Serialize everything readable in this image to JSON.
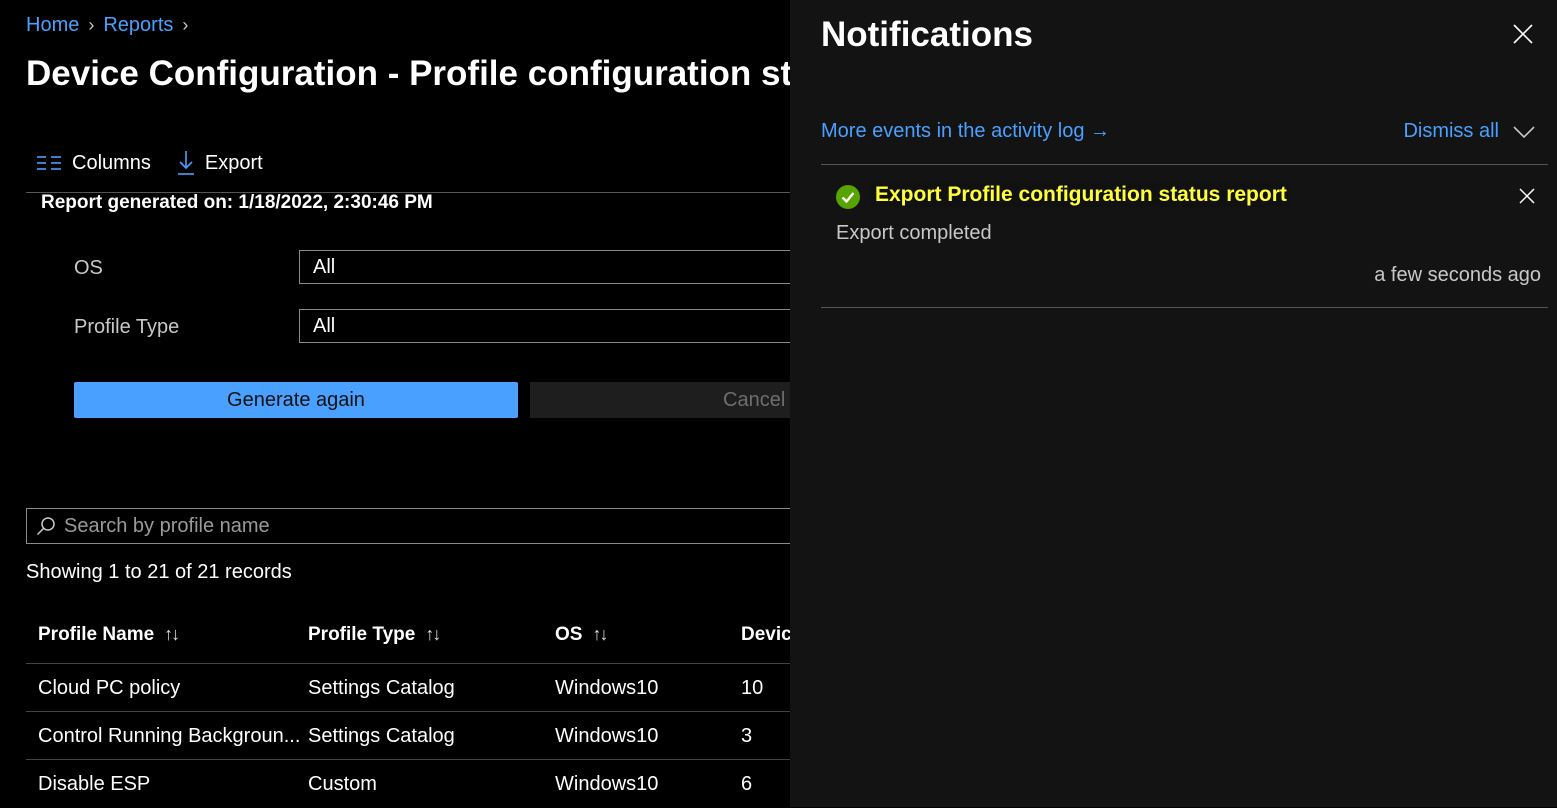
{
  "breadcrumb": {
    "items": [
      "Home",
      "Reports"
    ]
  },
  "page_title": "Device Configuration - Profile configuration sta",
  "toolbar": {
    "columns_label": "Columns",
    "export_label": "Export"
  },
  "report_generated": "Report generated on: 1/18/2022, 2:30:46 PM",
  "filters": [
    {
      "label": "OS",
      "value": "All"
    },
    {
      "label": "Profile Type",
      "value": "All"
    }
  ],
  "buttons": {
    "generate_label": "Generate again",
    "cancel_label": "Cancel"
  },
  "search": {
    "placeholder": "Search by profile name"
  },
  "records_text": "Showing 1 to 21 of 21 records",
  "table": {
    "headers": [
      "Profile Name",
      "Profile Type",
      "OS",
      "Devic"
    ],
    "sort_icon": "↑↓",
    "rows": [
      [
        "Cloud PC policy",
        "Settings Catalog",
        "Windows10",
        "10"
      ],
      [
        "Control Running Backgroun...",
        "Settings Catalog",
        "Windows10",
        "3"
      ],
      [
        "Disable ESP",
        "Custom",
        "Windows10",
        "6"
      ]
    ]
  },
  "notifications": {
    "title": "Notifications",
    "activity_link": "More events in the activity log →",
    "dismiss_all": "Dismiss all",
    "items": [
      {
        "title": "Export Profile configuration status report",
        "message": "Export completed",
        "time": "a few seconds ago",
        "status_color": "#57a300",
        "highlight_color": "#ffff3c"
      }
    ]
  },
  "colors": {
    "accent": "#4aa0ff",
    "panel_bg": "#131313",
    "page_bg": "#000000"
  }
}
